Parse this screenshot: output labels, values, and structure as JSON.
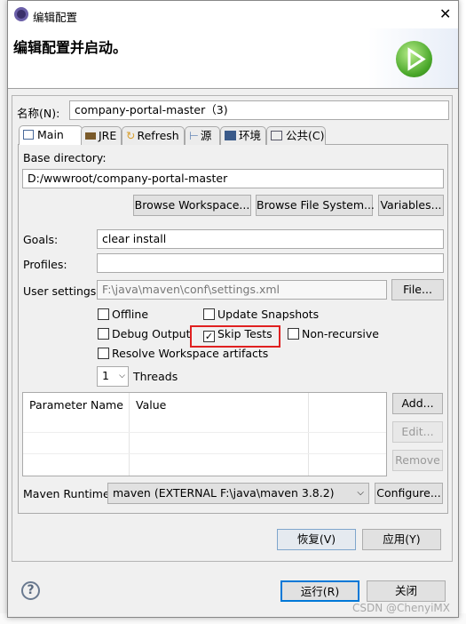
{
  "window": {
    "title": "编辑配置",
    "close": "✕",
    "header": "编辑配置并启动。"
  },
  "name": {
    "label": "名称(N):",
    "value": "company-portal-master（3)"
  },
  "tabs": [
    {
      "label": "Main"
    },
    {
      "label": "JRE"
    },
    {
      "label": "Refresh"
    },
    {
      "label": "源"
    },
    {
      "label": "环境"
    },
    {
      "label": "公共(C)"
    }
  ],
  "main": {
    "base_dir_label": "Base directory:",
    "base_dir_value": "D:/wwwroot/company-portal-master",
    "browse_workspace": "Browse Workspace...",
    "browse_fs": "Browse File System...",
    "variables": "Variables...",
    "goals_label": "Goals:",
    "goals_value": "clear install",
    "profiles_label": "Profiles:",
    "profiles_value": "",
    "user_settings_label": "User settings:",
    "user_settings_value": "F:\\java\\maven\\conf\\settings.xml",
    "file": "File...",
    "checkboxes": [
      {
        "label": "Offline",
        "checked": false
      },
      {
        "label": "Update Snapshots",
        "checked": false
      },
      {
        "label": "Debug Output",
        "checked": false
      },
      {
        "label": "Skip Tests",
        "checked": true,
        "highlight_color": "#e02020"
      },
      {
        "label": "Non-recursive",
        "checked": false
      },
      {
        "label": "Resolve Workspace artifacts",
        "checked": false
      }
    ],
    "threads_value": "1",
    "threads_label": "Threads",
    "table_headers": [
      "Parameter Name",
      "Value"
    ],
    "add": "Add...",
    "edit": "Edit...",
    "remove": "Remove",
    "runtime_label": "Maven Runtime:",
    "runtime_value": "maven (EXTERNAL F:\\java\\maven 3.8.2)",
    "configure": "Configure..."
  },
  "revert": "恢复(V)",
  "apply": "应用(Y)",
  "run": "运行(R)",
  "close_btn": "关闭",
  "help": "?",
  "watermark": "CSDN @ChenyiMX"
}
